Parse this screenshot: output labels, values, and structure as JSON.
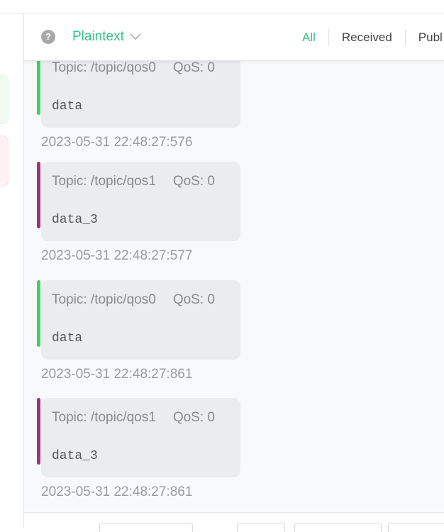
{
  "toolbar": {
    "help_icon": "question-circle-icon",
    "help_glyph": "?",
    "format": "Plaintext",
    "tabs": [
      {
        "label": "All",
        "active": true
      },
      {
        "label": "Received",
        "active": false
      },
      {
        "label": "Publ",
        "active": false
      }
    ]
  },
  "colors": {
    "accent": "#34c388",
    "topic_qos0": "#3bd35f",
    "topic_qos1": "#a0337a",
    "bubble": "#ebecef"
  },
  "messages": [
    {
      "topic": "Topic: /topic/qos0",
      "qos": "QoS: 0",
      "payload": "data",
      "time": "2023-05-31 22:48:27:576",
      "color": "#3bd35f"
    },
    {
      "topic": "Topic: /topic/qos1",
      "qos": "QoS: 0",
      "payload": "data_3",
      "time": "2023-05-31 22:48:27:577",
      "color": "#a0337a"
    },
    {
      "topic": "Topic: /topic/qos0",
      "qos": "QoS: 0",
      "payload": "data",
      "time": "2023-05-31 22:48:27:861",
      "color": "#3bd35f"
    },
    {
      "topic": "Topic: /topic/qos1",
      "qos": "QoS: 0",
      "payload": "data_3",
      "time": "2023-05-31 22:48:27:861",
      "color": "#a0337a"
    }
  ]
}
